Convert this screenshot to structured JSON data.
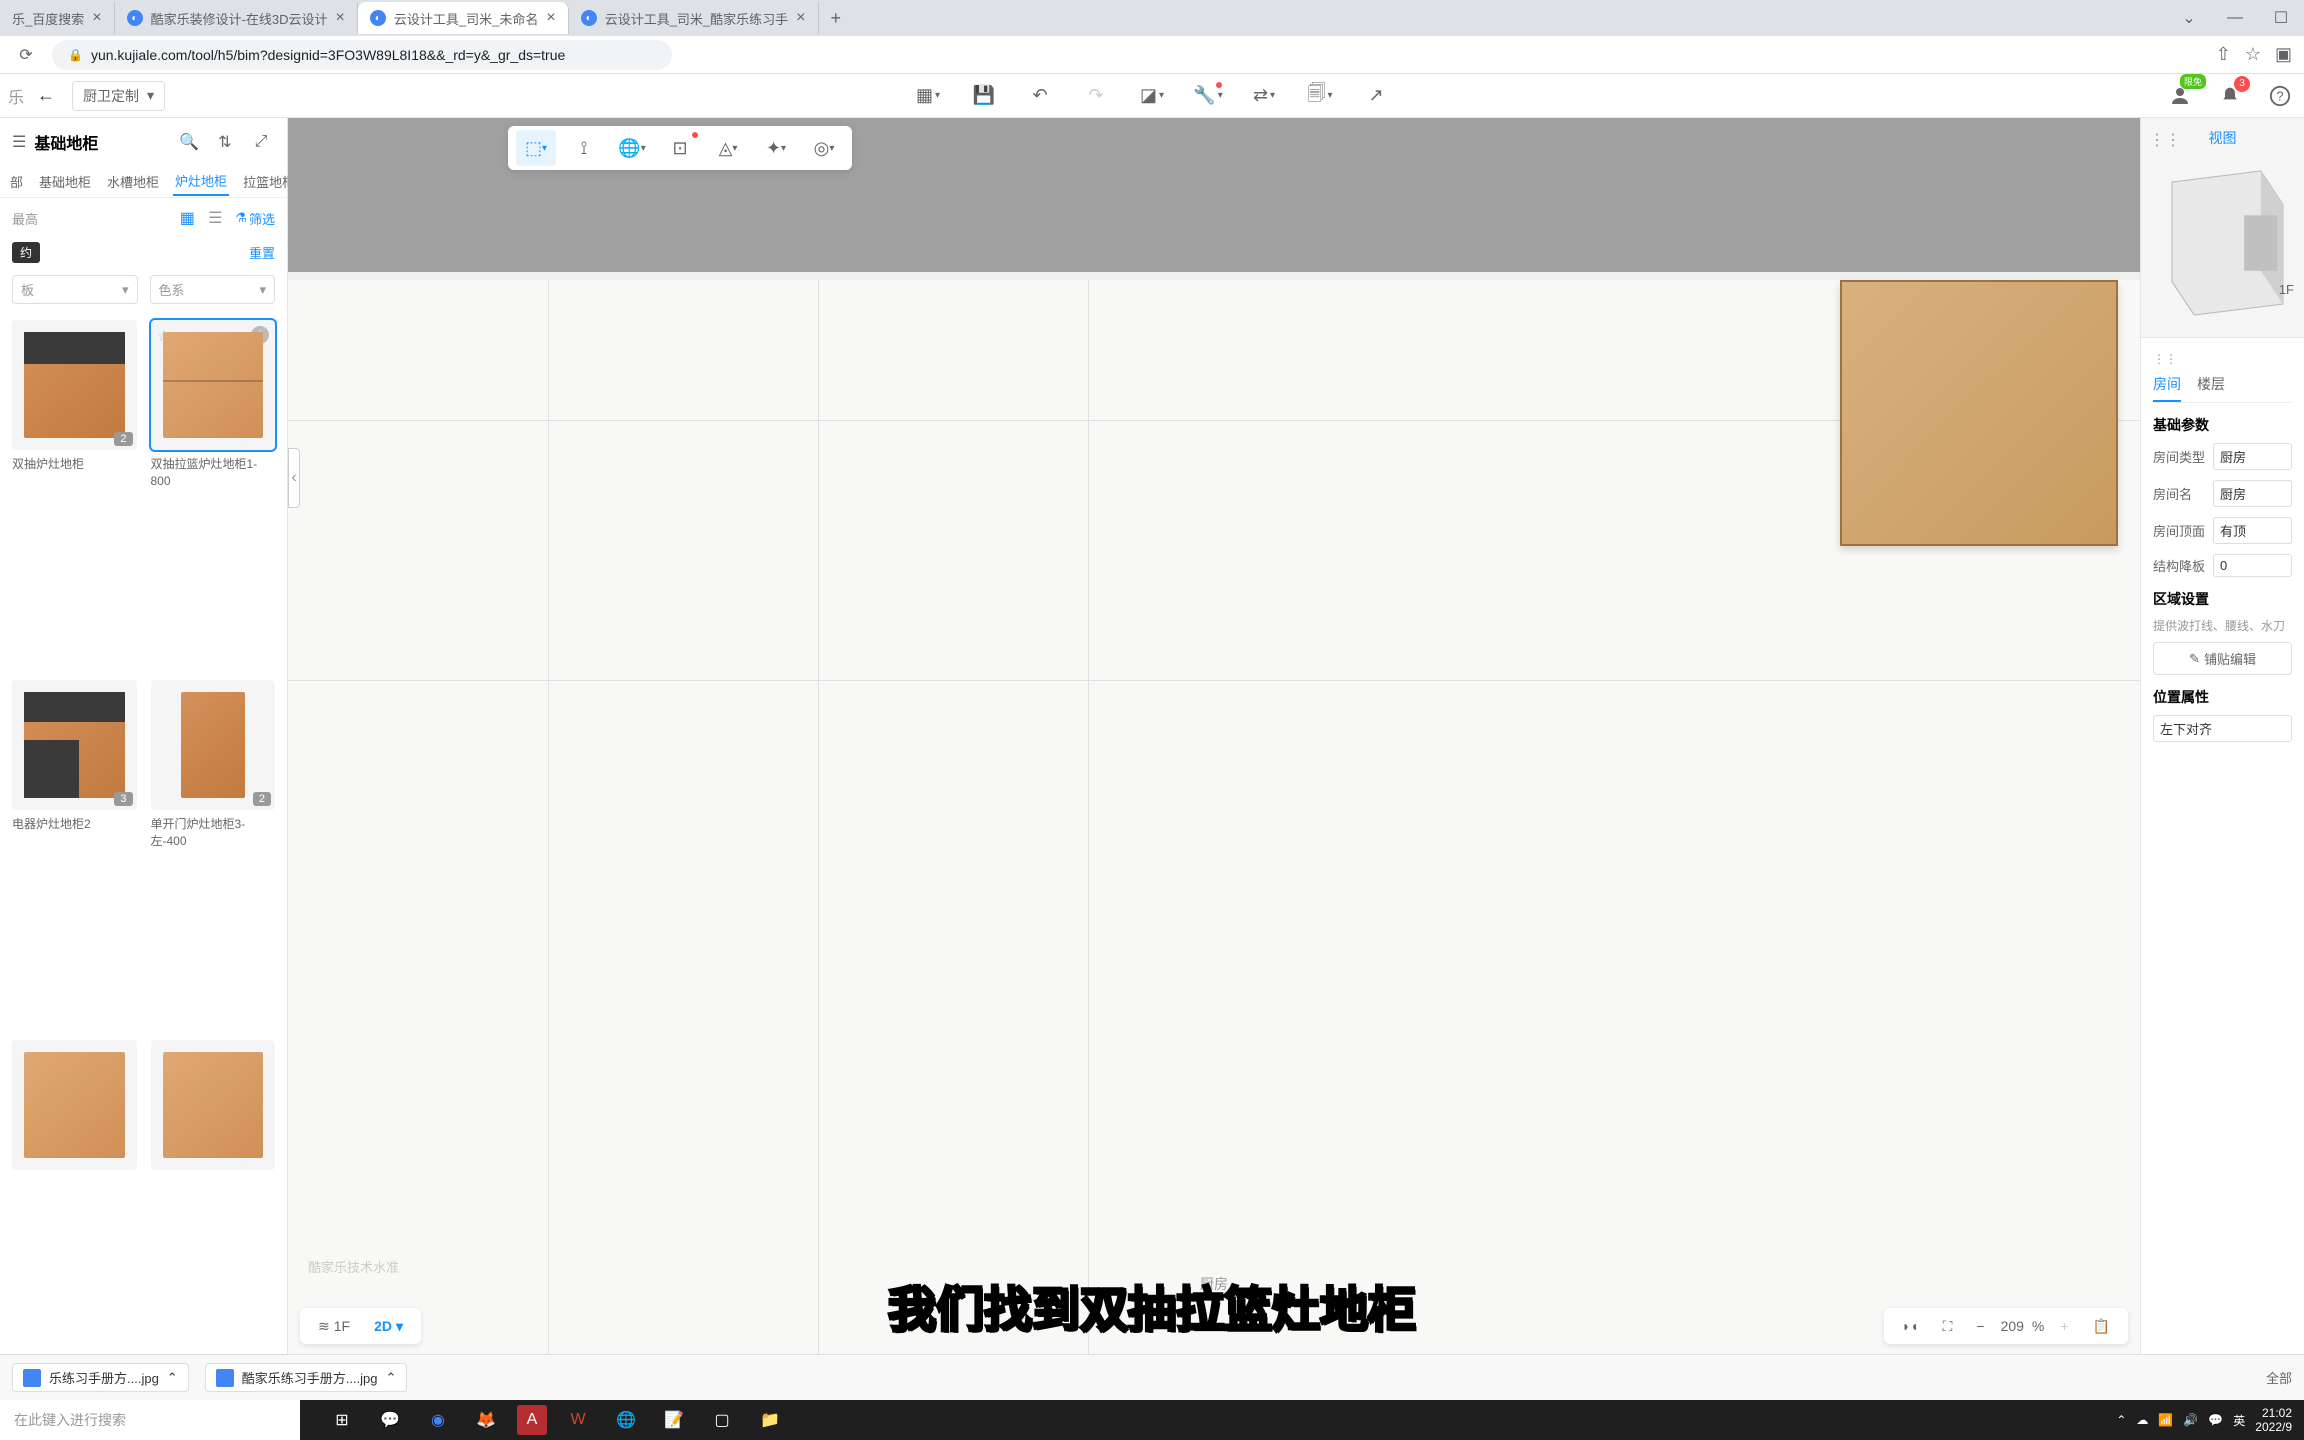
{
  "browser": {
    "tabs": [
      {
        "label": "乐_百度搜索",
        "icon": "baidu"
      },
      {
        "label": "酷家乐装修设计-在线3D云设计",
        "icon": "kujiale"
      },
      {
        "label": "云设计工具_司米_未命名",
        "icon": "kujiale",
        "active": true
      },
      {
        "label": "云设计工具_司米_酷家乐练习手",
        "icon": "kujiale"
      }
    ],
    "url": "yun.kujiale.com/tool/h5/bim?designid=3FO3W89L8I18&&_rd=y&_gr_ds=true"
  },
  "app": {
    "mode": "厨卫定制",
    "user_tag": "限免",
    "notif_count": "3"
  },
  "sidebar": {
    "title": "基础地柜",
    "categories": [
      "部",
      "基础地柜",
      "水槽地柜",
      "炉灶地柜",
      "拉篮地柜"
    ],
    "active_cat": 3,
    "sort": "最高",
    "filter_label": "筛选",
    "tag": "约",
    "reset": "重置",
    "dd1": "板",
    "dd2": "色系",
    "products": [
      {
        "name": "双抽炉灶地柜",
        "count": "2",
        "style": "stove"
      },
      {
        "name": "双抽拉篮炉灶地柜1-800",
        "count": "",
        "style": "drawers",
        "hover": true
      },
      {
        "name": "电器炉灶地柜2",
        "count": "3",
        "style": "appliance"
      },
      {
        "name": "单开门炉灶地柜3-左-400",
        "count": "2",
        "style": "single"
      },
      {
        "name": "",
        "count": "",
        "style": "open"
      },
      {
        "name": "",
        "count": "",
        "style": "open2"
      }
    ]
  },
  "canvas": {
    "room_label": "厨房",
    "watermark": "酷家乐技术水准",
    "floor_btn": "1F",
    "view_btn": "2D",
    "zoom": "209",
    "zoom_unit": "%"
  },
  "preview": {
    "tab": "视图",
    "floor": "1F"
  },
  "props": {
    "tabs": [
      "房间",
      "楼层"
    ],
    "section1": "基础参数",
    "rows": [
      {
        "label": "房间类型",
        "value": "厨房"
      },
      {
        "label": "房间名",
        "value": "厨房"
      },
      {
        "label": "房间顶面",
        "value": "有顶"
      },
      {
        "label": "结构降板",
        "value": "0"
      }
    ],
    "section2": "区域设置",
    "desc": "提供波打线、腰线、水刀",
    "edit_btn": "铺贴编辑",
    "section3": "位置属性",
    "align": "左下对齐"
  },
  "downloads": {
    "items": [
      "乐练习手册方....jpg",
      "酷家乐练习手册方....jpg"
    ],
    "all": "全部"
  },
  "taskbar": {
    "search_placeholder": "在此键入进行搜索",
    "ime": "英",
    "time": "21:02",
    "date": "2022/9"
  },
  "subtitle": "我们找到双抽拉篮灶地柜"
}
